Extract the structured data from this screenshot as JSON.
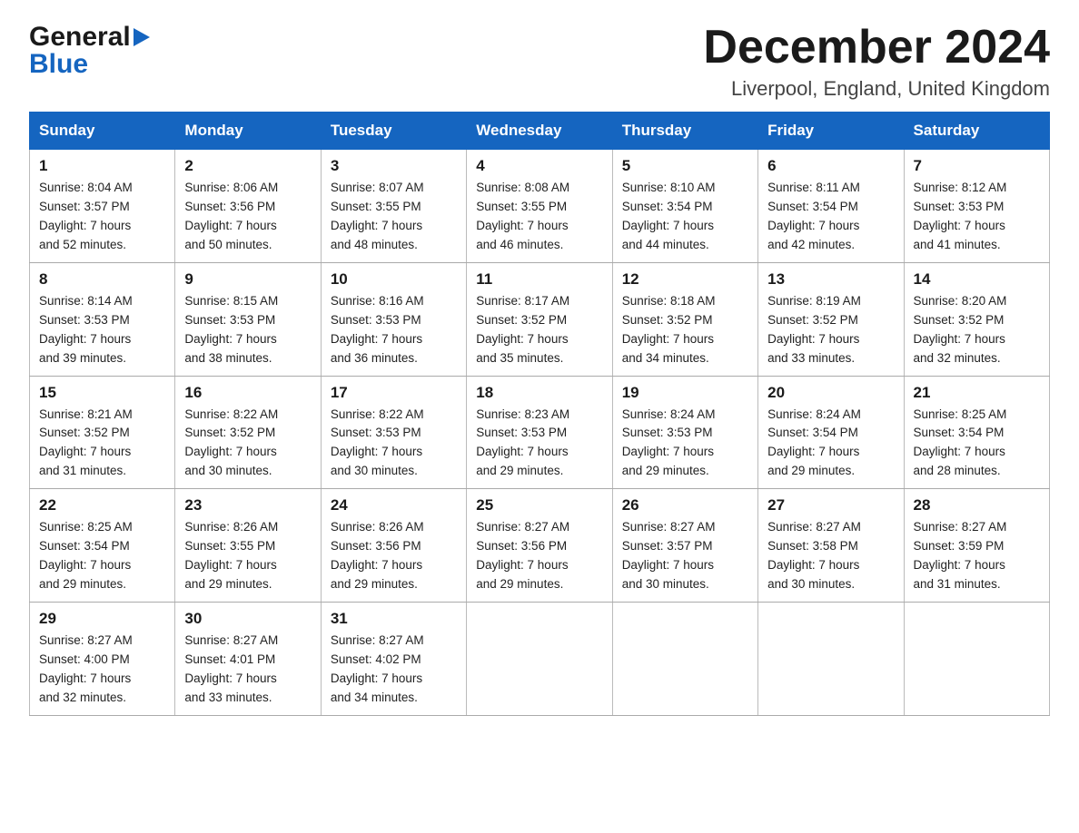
{
  "header": {
    "logo_general": "General",
    "logo_blue": "Blue",
    "month_title": "December 2024",
    "location": "Liverpool, England, United Kingdom"
  },
  "days_of_week": [
    "Sunday",
    "Monday",
    "Tuesday",
    "Wednesday",
    "Thursday",
    "Friday",
    "Saturday"
  ],
  "weeks": [
    [
      {
        "day": "1",
        "sunrise": "Sunrise: 8:04 AM",
        "sunset": "Sunset: 3:57 PM",
        "daylight": "Daylight: 7 hours",
        "daylight2": "and 52 minutes."
      },
      {
        "day": "2",
        "sunrise": "Sunrise: 8:06 AM",
        "sunset": "Sunset: 3:56 PM",
        "daylight": "Daylight: 7 hours",
        "daylight2": "and 50 minutes."
      },
      {
        "day": "3",
        "sunrise": "Sunrise: 8:07 AM",
        "sunset": "Sunset: 3:55 PM",
        "daylight": "Daylight: 7 hours",
        "daylight2": "and 48 minutes."
      },
      {
        "day": "4",
        "sunrise": "Sunrise: 8:08 AM",
        "sunset": "Sunset: 3:55 PM",
        "daylight": "Daylight: 7 hours",
        "daylight2": "and 46 minutes."
      },
      {
        "day": "5",
        "sunrise": "Sunrise: 8:10 AM",
        "sunset": "Sunset: 3:54 PM",
        "daylight": "Daylight: 7 hours",
        "daylight2": "and 44 minutes."
      },
      {
        "day": "6",
        "sunrise": "Sunrise: 8:11 AM",
        "sunset": "Sunset: 3:54 PM",
        "daylight": "Daylight: 7 hours",
        "daylight2": "and 42 minutes."
      },
      {
        "day": "7",
        "sunrise": "Sunrise: 8:12 AM",
        "sunset": "Sunset: 3:53 PM",
        "daylight": "Daylight: 7 hours",
        "daylight2": "and 41 minutes."
      }
    ],
    [
      {
        "day": "8",
        "sunrise": "Sunrise: 8:14 AM",
        "sunset": "Sunset: 3:53 PM",
        "daylight": "Daylight: 7 hours",
        "daylight2": "and 39 minutes."
      },
      {
        "day": "9",
        "sunrise": "Sunrise: 8:15 AM",
        "sunset": "Sunset: 3:53 PM",
        "daylight": "Daylight: 7 hours",
        "daylight2": "and 38 minutes."
      },
      {
        "day": "10",
        "sunrise": "Sunrise: 8:16 AM",
        "sunset": "Sunset: 3:53 PM",
        "daylight": "Daylight: 7 hours",
        "daylight2": "and 36 minutes."
      },
      {
        "day": "11",
        "sunrise": "Sunrise: 8:17 AM",
        "sunset": "Sunset: 3:52 PM",
        "daylight": "Daylight: 7 hours",
        "daylight2": "and 35 minutes."
      },
      {
        "day": "12",
        "sunrise": "Sunrise: 8:18 AM",
        "sunset": "Sunset: 3:52 PM",
        "daylight": "Daylight: 7 hours",
        "daylight2": "and 34 minutes."
      },
      {
        "day": "13",
        "sunrise": "Sunrise: 8:19 AM",
        "sunset": "Sunset: 3:52 PM",
        "daylight": "Daylight: 7 hours",
        "daylight2": "and 33 minutes."
      },
      {
        "day": "14",
        "sunrise": "Sunrise: 8:20 AM",
        "sunset": "Sunset: 3:52 PM",
        "daylight": "Daylight: 7 hours",
        "daylight2": "and 32 minutes."
      }
    ],
    [
      {
        "day": "15",
        "sunrise": "Sunrise: 8:21 AM",
        "sunset": "Sunset: 3:52 PM",
        "daylight": "Daylight: 7 hours",
        "daylight2": "and 31 minutes."
      },
      {
        "day": "16",
        "sunrise": "Sunrise: 8:22 AM",
        "sunset": "Sunset: 3:52 PM",
        "daylight": "Daylight: 7 hours",
        "daylight2": "and 30 minutes."
      },
      {
        "day": "17",
        "sunrise": "Sunrise: 8:22 AM",
        "sunset": "Sunset: 3:53 PM",
        "daylight": "Daylight: 7 hours",
        "daylight2": "and 30 minutes."
      },
      {
        "day": "18",
        "sunrise": "Sunrise: 8:23 AM",
        "sunset": "Sunset: 3:53 PM",
        "daylight": "Daylight: 7 hours",
        "daylight2": "and 29 minutes."
      },
      {
        "day": "19",
        "sunrise": "Sunrise: 8:24 AM",
        "sunset": "Sunset: 3:53 PM",
        "daylight": "Daylight: 7 hours",
        "daylight2": "and 29 minutes."
      },
      {
        "day": "20",
        "sunrise": "Sunrise: 8:24 AM",
        "sunset": "Sunset: 3:54 PM",
        "daylight": "Daylight: 7 hours",
        "daylight2": "and 29 minutes."
      },
      {
        "day": "21",
        "sunrise": "Sunrise: 8:25 AM",
        "sunset": "Sunset: 3:54 PM",
        "daylight": "Daylight: 7 hours",
        "daylight2": "and 28 minutes."
      }
    ],
    [
      {
        "day": "22",
        "sunrise": "Sunrise: 8:25 AM",
        "sunset": "Sunset: 3:54 PM",
        "daylight": "Daylight: 7 hours",
        "daylight2": "and 29 minutes."
      },
      {
        "day": "23",
        "sunrise": "Sunrise: 8:26 AM",
        "sunset": "Sunset: 3:55 PM",
        "daylight": "Daylight: 7 hours",
        "daylight2": "and 29 minutes."
      },
      {
        "day": "24",
        "sunrise": "Sunrise: 8:26 AM",
        "sunset": "Sunset: 3:56 PM",
        "daylight": "Daylight: 7 hours",
        "daylight2": "and 29 minutes."
      },
      {
        "day": "25",
        "sunrise": "Sunrise: 8:27 AM",
        "sunset": "Sunset: 3:56 PM",
        "daylight": "Daylight: 7 hours",
        "daylight2": "and 29 minutes."
      },
      {
        "day": "26",
        "sunrise": "Sunrise: 8:27 AM",
        "sunset": "Sunset: 3:57 PM",
        "daylight": "Daylight: 7 hours",
        "daylight2": "and 30 minutes."
      },
      {
        "day": "27",
        "sunrise": "Sunrise: 8:27 AM",
        "sunset": "Sunset: 3:58 PM",
        "daylight": "Daylight: 7 hours",
        "daylight2": "and 30 minutes."
      },
      {
        "day": "28",
        "sunrise": "Sunrise: 8:27 AM",
        "sunset": "Sunset: 3:59 PM",
        "daylight": "Daylight: 7 hours",
        "daylight2": "and 31 minutes."
      }
    ],
    [
      {
        "day": "29",
        "sunrise": "Sunrise: 8:27 AM",
        "sunset": "Sunset: 4:00 PM",
        "daylight": "Daylight: 7 hours",
        "daylight2": "and 32 minutes."
      },
      {
        "day": "30",
        "sunrise": "Sunrise: 8:27 AM",
        "sunset": "Sunset: 4:01 PM",
        "daylight": "Daylight: 7 hours",
        "daylight2": "and 33 minutes."
      },
      {
        "day": "31",
        "sunrise": "Sunrise: 8:27 AM",
        "sunset": "Sunset: 4:02 PM",
        "daylight": "Daylight: 7 hours",
        "daylight2": "and 34 minutes."
      },
      null,
      null,
      null,
      null
    ]
  ]
}
